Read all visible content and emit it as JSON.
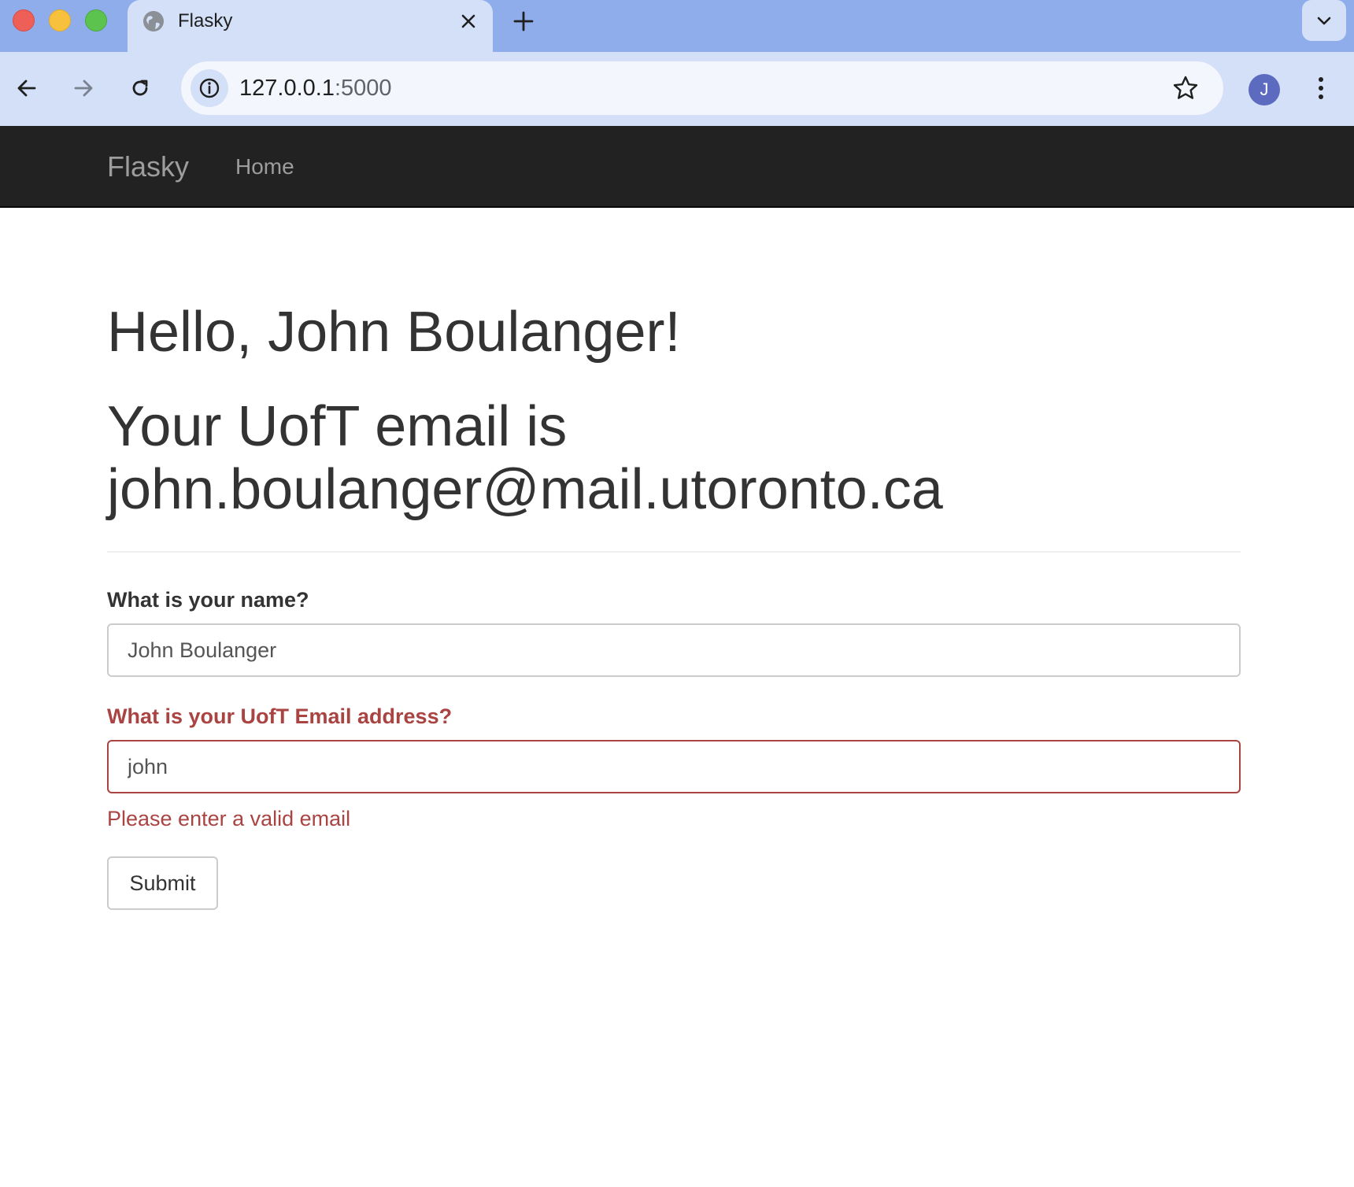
{
  "browser": {
    "tab_title": "Flasky",
    "url_host": "127.0.0.1",
    "url_port": ":5000",
    "avatar_initial": "J",
    "icons": [
      "globe-icon",
      "close-icon",
      "plus-icon",
      "chevron-down-icon",
      "back-arrow-icon",
      "forward-arrow-icon",
      "reload-icon",
      "info-icon",
      "star-icon",
      "kebab-menu-icon"
    ]
  },
  "navbar": {
    "brand": "Flasky",
    "home": "Home"
  },
  "main": {
    "greeting": "Hello, John Boulanger!",
    "email_heading": "Your UofT email is john.boulanger@mail.utoronto.ca"
  },
  "form": {
    "name_label": "What is your name?",
    "name_value": "John Boulanger",
    "email_label": "What is your UofT Email address?",
    "email_value": "john",
    "email_error": "Please enter a valid email",
    "submit_label": "Submit"
  },
  "colors": {
    "error": "#a94442",
    "navbar_bg": "#222222",
    "chrome_tabstrip": "#8eadea",
    "chrome_toolbar": "#d3e0f7"
  }
}
